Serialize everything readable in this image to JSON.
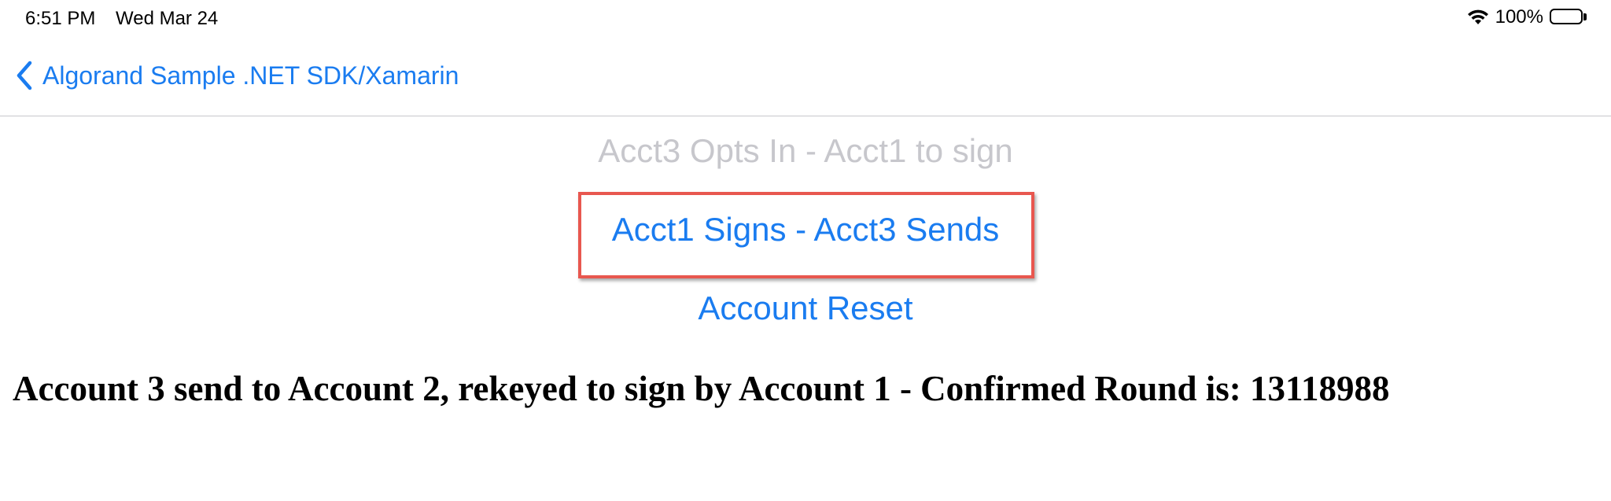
{
  "status_bar": {
    "time": "6:51 PM",
    "date": "Wed Mar 24",
    "battery": "100%",
    "icons": [
      "wifi-icon",
      "battery-icon"
    ]
  },
  "nav": {
    "back_label": "Algorand Sample .NET SDK/Xamarin",
    "back_icon": "chevron-left-icon"
  },
  "buttons": {
    "opt_in": "Acct3 Opts In - Acct1 to sign",
    "sign_send": "Acct1 Signs - Acct3 Sends",
    "reset": "Account Reset"
  },
  "result": {
    "message": "Account 3 send to Account 2, rekeyed to sign by Account 1 - Confirmed Round is: 13118988"
  },
  "colors": {
    "accent": "#1a7cf0",
    "disabled": "#c7c7cc",
    "highlight": "#e8574f"
  }
}
